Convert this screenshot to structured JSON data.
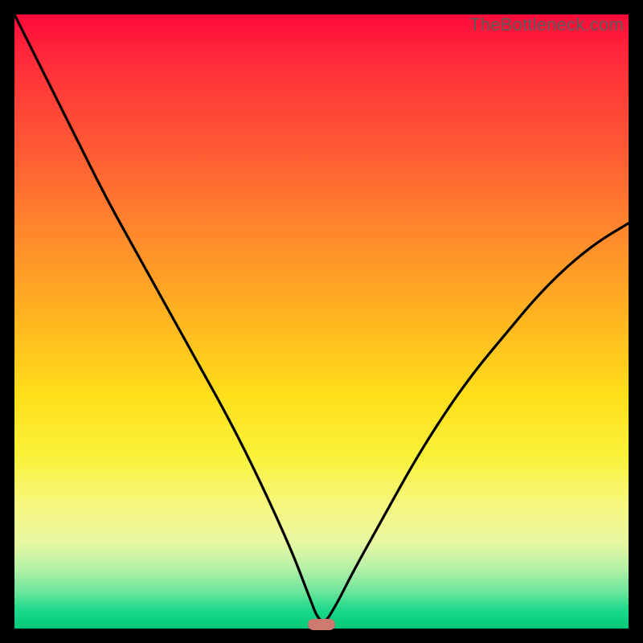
{
  "watermark": "TheBottleneck.com",
  "chart_data": {
    "type": "line",
    "title": "",
    "xlabel": "",
    "ylabel": "",
    "xlim": [
      0,
      1
    ],
    "ylim": [
      0,
      1
    ],
    "series": [
      {
        "name": "bottleneck-curve",
        "x": [
          0.0,
          0.05,
          0.1,
          0.15,
          0.2,
          0.25,
          0.3,
          0.35,
          0.4,
          0.45,
          0.475,
          0.5,
          0.525,
          0.55,
          0.6,
          0.65,
          0.7,
          0.75,
          0.8,
          0.85,
          0.9,
          0.95,
          1.0
        ],
        "y": [
          1.0,
          0.9,
          0.8,
          0.7,
          0.61,
          0.52,
          0.43,
          0.34,
          0.24,
          0.13,
          0.065,
          0.0,
          0.04,
          0.09,
          0.18,
          0.27,
          0.35,
          0.42,
          0.48,
          0.54,
          0.59,
          0.63,
          0.66
        ]
      }
    ],
    "marker": {
      "x": 0.5,
      "y": 0.0
    },
    "gradient_stops": [
      {
        "pos": 0.0,
        "color": "#ff0a3a"
      },
      {
        "pos": 0.5,
        "color": "#ffdf1a"
      },
      {
        "pos": 1.0,
        "color": "#00c97a"
      }
    ]
  }
}
